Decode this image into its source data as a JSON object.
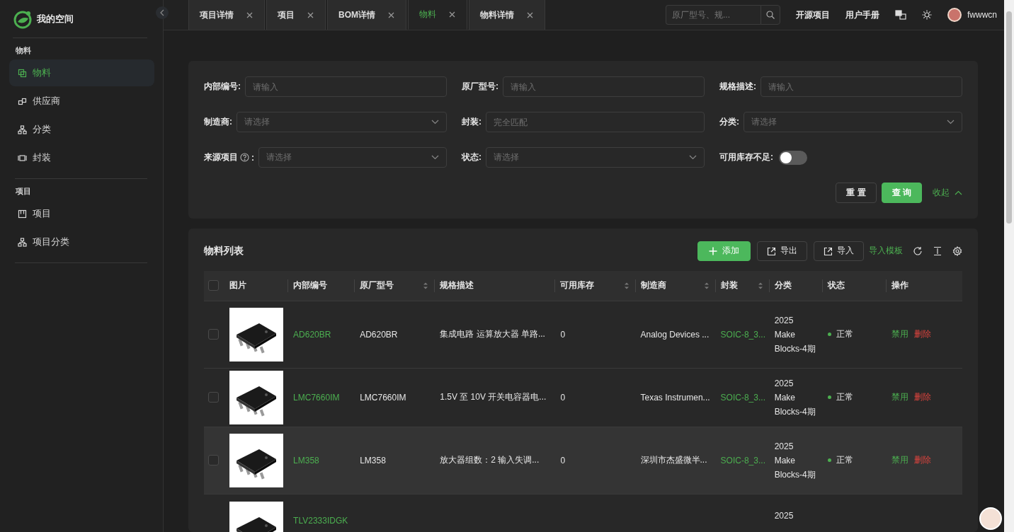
{
  "sidebar": {
    "brand": "我的空间",
    "sections": [
      {
        "title": "物料",
        "items": [
          {
            "label": "物料",
            "selected": true
          },
          {
            "label": "供应商",
            "selected": false
          },
          {
            "label": "分类",
            "selected": false
          },
          {
            "label": "封装",
            "selected": false
          }
        ]
      },
      {
        "title": "项目",
        "items": [
          {
            "label": "项目",
            "selected": false
          },
          {
            "label": "项目分类",
            "selected": false
          }
        ]
      }
    ]
  },
  "tabs": [
    {
      "label": "项目详情",
      "selected": false
    },
    {
      "label": "项目",
      "selected": false
    },
    {
      "label": "BOM详情",
      "selected": false
    },
    {
      "label": "物料",
      "selected": true
    },
    {
      "label": "物料详情",
      "selected": false
    }
  ],
  "header": {
    "search": {
      "placeholder": "原厂型号、规..."
    },
    "links": [
      "开源项目",
      "用户手册"
    ],
    "user": "fwwwcn"
  },
  "filters": [
    {
      "kind": "input",
      "label": "内部编号:",
      "placeholder": "请输入"
    },
    {
      "kind": "input",
      "label": "原厂型号:",
      "placeholder": "请输入"
    },
    {
      "kind": "input",
      "label": "规格描述:",
      "placeholder": "请输入"
    },
    {
      "kind": "select",
      "label": "制造商:",
      "placeholder": "请选择"
    },
    {
      "kind": "input",
      "label": "封装:",
      "placeholder": "完全匹配"
    },
    {
      "kind": "select",
      "label": "分类:",
      "placeholder": "请选择"
    },
    {
      "kind": "select",
      "label": "来源项目",
      "help_suffix": ":",
      "placeholder": "请选择"
    },
    {
      "kind": "select",
      "label": "状态:",
      "placeholder": "请选择"
    },
    {
      "kind": "switch",
      "label": "可用库存不足:",
      "on": false
    }
  ],
  "filter_actions": {
    "reset": "重 置",
    "query": "查 询",
    "collapse": "收起"
  },
  "list": {
    "title": "物料列表",
    "buttons": [
      {
        "kind": "primary",
        "label": "添加"
      },
      {
        "kind": "default",
        "label": "导出"
      },
      {
        "kind": "default",
        "label": "导入"
      }
    ],
    "template_link": "导入模板",
    "all_checked": false,
    "columns": [
      {
        "label": "图片",
        "sortable": false
      },
      {
        "label": "内部编号",
        "sortable": false
      },
      {
        "label": "原厂型号",
        "sortable": true
      },
      {
        "label": "规格描述",
        "sortable": false
      },
      {
        "label": "可用库存",
        "sortable": true
      },
      {
        "label": "制造商",
        "sortable": true
      },
      {
        "label": "封装",
        "sortable": true
      },
      {
        "label": "分类",
        "sortable": false
      },
      {
        "label": "状态",
        "sortable": false
      },
      {
        "label": "操作",
        "sortable": false
      }
    ],
    "rows": [
      {
        "checked": false,
        "hovered": false,
        "image": {
          "kind": "picture"
        },
        "internal_code": "AD620BR",
        "part_number": "AD620BR",
        "description": "集成电路 运算放大器 单路...",
        "stock": "0",
        "manufacturer": "Analog Devices ...",
        "package": "SOIC-8_3...",
        "category": "2025 Make Blocks-4期",
        "status": "正常",
        "actions": [
          "禁用",
          "删除"
        ]
      },
      {
        "checked": false,
        "hovered": false,
        "image": {
          "kind": "picture"
        },
        "internal_code": "LMC7660IM",
        "part_number": "LMC7660IM",
        "description": "1.5V 至 10V 开关电容器电...",
        "stock": "0",
        "manufacturer": "Texas Instrumen...",
        "package": "SOIC-8_3...",
        "category": "2025 Make Blocks-4期",
        "status": "正常",
        "actions": [
          "禁用",
          "删除"
        ]
      },
      {
        "checked": false,
        "hovered": true,
        "image": {
          "kind": "picture"
        },
        "internal_code": "LM358",
        "part_number": "LM358",
        "description": "放大器组数：2 输入失调...",
        "stock": "0",
        "manufacturer": "深圳市杰盛微半...",
        "package": "SOIC-8_3...",
        "category": "2025 Make Blocks-4期",
        "status": "正常",
        "actions": [
          "禁用",
          "删除"
        ]
      },
      {
        "hovered": false,
        "image": {
          "kind": "picture"
        },
        "internal_code": "TLV2333IDGK",
        "category": "2025"
      }
    ]
  }
}
